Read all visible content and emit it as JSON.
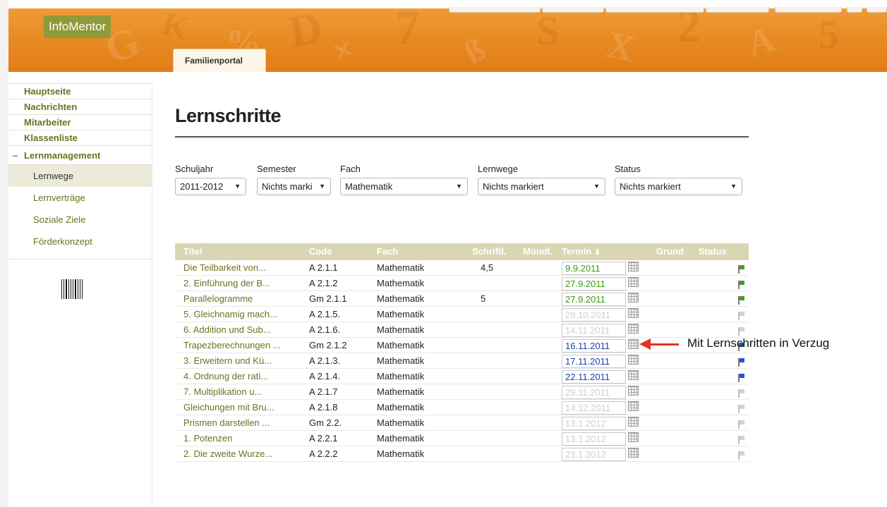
{
  "brand": {
    "logo": "InfoMentor",
    "portal_tab": "Familienportal"
  },
  "sidebar": {
    "items": [
      "Hauptseite",
      "Nachrichten",
      "Mitarbeiter",
      "Klassenliste"
    ],
    "section": "Lernmanagement",
    "section_icon": "minus-icon",
    "subitems": [
      "Lernwege",
      "Lernverträge",
      "Soziale Ziele",
      "Förderkonzept"
    ],
    "active_subitem": "Lernwege"
  },
  "main": {
    "title": "Lernschritte",
    "filters": [
      {
        "label": "Schuljahr",
        "value": "2011-2012"
      },
      {
        "label": "Semester",
        "value": "Nichts marki"
      },
      {
        "label": "Fach",
        "value": "Mathematik"
      },
      {
        "label": "Lernwege",
        "value": "Nichts markiert"
      },
      {
        "label": "Status",
        "value": "Nichts markiert"
      }
    ]
  },
  "table": {
    "headers": {
      "titel": "Titel",
      "code": "Code",
      "fach": "Fach",
      "schriftl": "Schriftl.",
      "muendl": "Mündl.",
      "termin": "Termin",
      "grund": "Grund",
      "status": "Status"
    },
    "sort_icon": "sort-down-arrow-icon",
    "rows": [
      {
        "titel": "Die Teilbarkeit von...",
        "code": "A 2.1.1",
        "fach": "Mathematik",
        "schriftl": "4,5",
        "muendl": "",
        "termin": "9.9.2011",
        "termin_color": "green",
        "flag": "green"
      },
      {
        "titel": "2. Einführung der B...",
        "code": "A 2.1.2",
        "fach": "Mathematik",
        "schriftl": "",
        "muendl": "",
        "termin": "27.9.2011",
        "termin_color": "green",
        "flag": "green"
      },
      {
        "titel": "Parallelogramme",
        "code": "Gm 2.1.1",
        "fach": "Mathematik",
        "schriftl": "5",
        "muendl": "",
        "termin": "27.9.2011",
        "termin_color": "green",
        "flag": "green"
      },
      {
        "titel": "5. Gleichnamig mach...",
        "code": "A 2.1.5.",
        "fach": "Mathematik",
        "schriftl": "",
        "muendl": "",
        "termin": "28.10.2011",
        "termin_color": "grey",
        "flag": "grey"
      },
      {
        "titel": "6. Addition und Sub...",
        "code": "A 2.1.6.",
        "fach": "Mathematik",
        "schriftl": "",
        "muendl": "",
        "termin": "14.11.2011",
        "termin_color": "grey",
        "flag": "grey"
      },
      {
        "titel": "Trapezberechnungen ...",
        "code": "Gm 2.1.2",
        "fach": "Mathematik",
        "schriftl": "",
        "muendl": "",
        "termin": "16.11.2011",
        "termin_color": "blue",
        "flag": "blue"
      },
      {
        "titel": "3. Erweitern und Kü...",
        "code": "A 2.1.3.",
        "fach": "Mathematik",
        "schriftl": "",
        "muendl": "",
        "termin": "17.11.2011",
        "termin_color": "blue",
        "flag": "blue"
      },
      {
        "titel": "4. Ordnung der rati...",
        "code": "A 2.1.4.",
        "fach": "Mathematik",
        "schriftl": "",
        "muendl": "",
        "termin": "22.11.2011",
        "termin_color": "blue",
        "flag": "blue"
      },
      {
        "titel": "7. Multiplikation u...",
        "code": "A 2.1.7",
        "fach": "Mathematik",
        "schriftl": "",
        "muendl": "",
        "termin": "29.11.2011",
        "termin_color": "grey",
        "flag": "grey"
      },
      {
        "titel": "Gleichungen mit Bru...",
        "code": "A 2.1.8",
        "fach": "Mathematik",
        "schriftl": "",
        "muendl": "",
        "termin": "14.12.2011",
        "termin_color": "grey",
        "flag": "grey"
      },
      {
        "titel": "Prismen darstellen ...",
        "code": "Gm 2.2.",
        "fach": "Mathematik",
        "schriftl": "",
        "muendl": "",
        "termin": "13.1.2012",
        "termin_color": "grey",
        "flag": "grey"
      },
      {
        "titel": "1. Potenzen",
        "code": "A 2.2.1",
        "fach": "Mathematik",
        "schriftl": "",
        "muendl": "",
        "termin": "13.1.2012",
        "termin_color": "grey",
        "flag": "grey"
      },
      {
        "titel": "2. Die zweite Wurze...",
        "code": "A 2.2.2",
        "fach": "Mathematik",
        "schriftl": "",
        "muendl": "",
        "termin": "23.1.2012",
        "termin_color": "grey",
        "flag": "grey"
      }
    ]
  },
  "annotation": {
    "text": "Mit Lernschritten in Verzug",
    "color": "#e53222"
  },
  "colors": {
    "header": "#e88a22",
    "logo_bg": "#8f9a3a",
    "link": "#6b7220",
    "table_header": "#dad6b3"
  }
}
